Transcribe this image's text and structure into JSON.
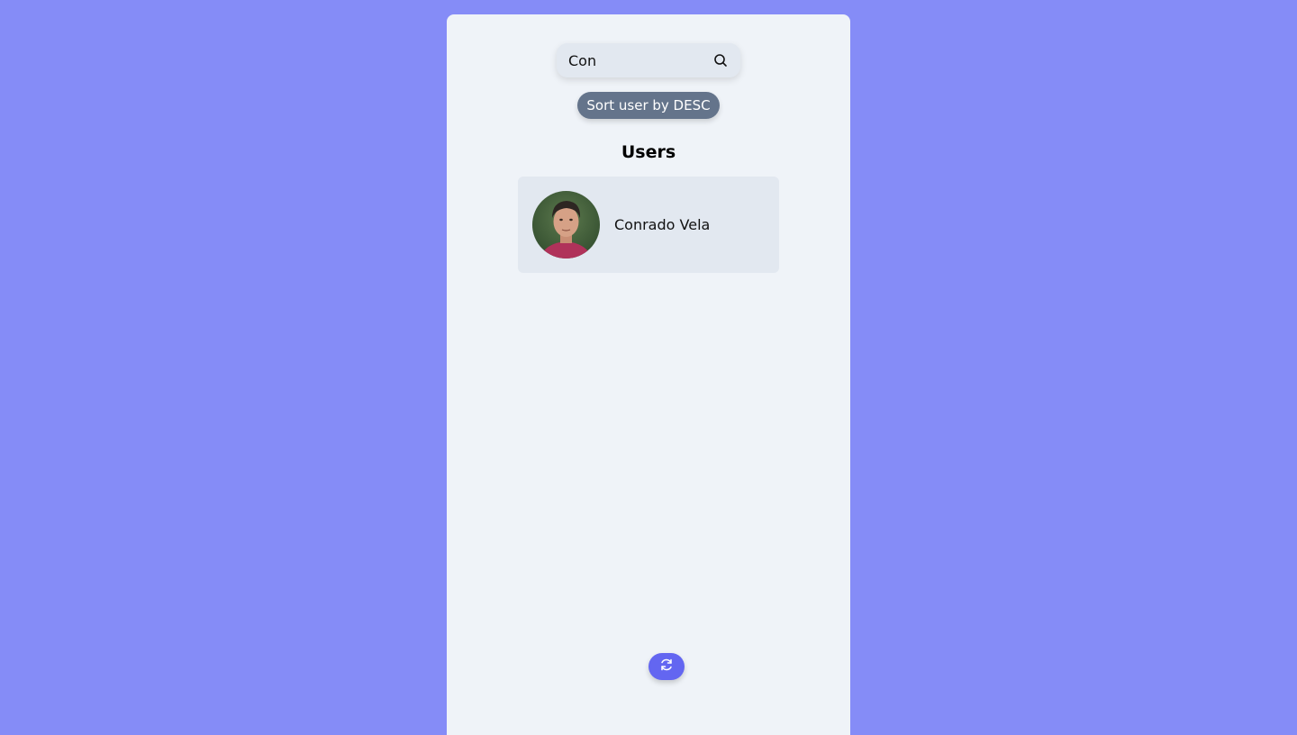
{
  "search": {
    "value": "Con",
    "icon": "search-icon"
  },
  "sort_button": {
    "label": "Sort user by DESC"
  },
  "users_section": {
    "title": "Users",
    "users": [
      {
        "name": "Conrado Vela",
        "avatar": "avatar-photo"
      }
    ]
  },
  "refresh_button": {
    "icon": "refresh-icon"
  },
  "colors": {
    "background": "#858cf7",
    "panel": "#eff3f8",
    "card": "#e2e8f0",
    "sort_button": "#64748b",
    "accent": "#6366f1"
  }
}
